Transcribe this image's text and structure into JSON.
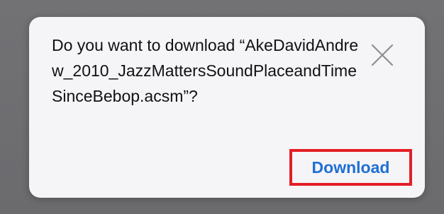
{
  "dialog": {
    "message": "Do you want to download “AkeDavidAndrew_2010_JazzMattersSoundPlaceandTimeSinceBebop.acsm”?",
    "close_icon": "close-x-icon",
    "download_label": "Download"
  },
  "colors": {
    "backdrop": "#6f6f72",
    "dialog_bg": "#f5f5f7",
    "text": "#111114",
    "link_blue": "#1f6fd6",
    "highlight_red": "#e41e26",
    "close_icon_gray": "#8e8e93"
  }
}
